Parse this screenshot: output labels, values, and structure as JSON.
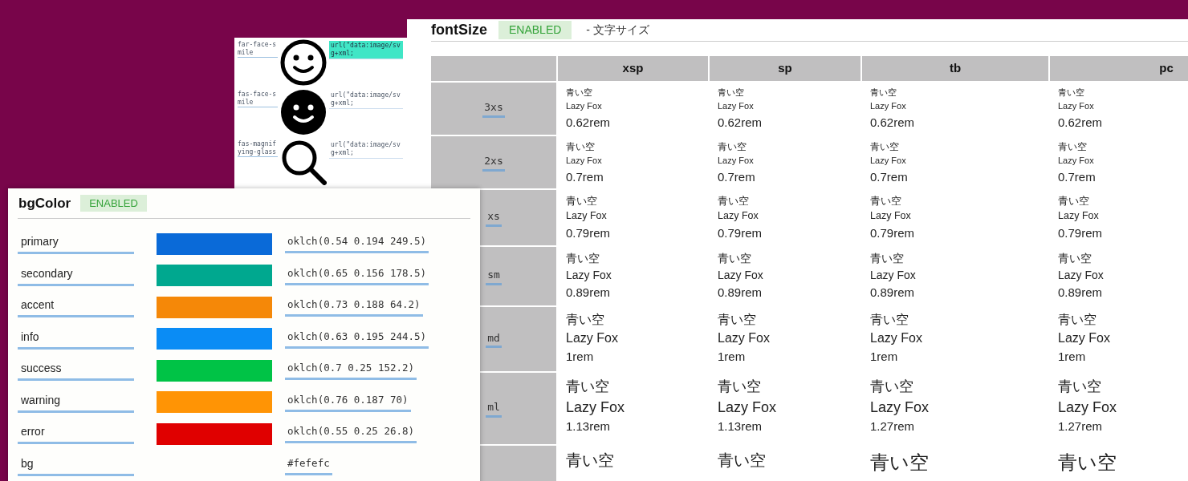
{
  "icon_panel": {
    "rows": [
      {
        "name": "far-face-smile",
        "kind": "face-outline",
        "code": "url(\"data:image/svg+xml;",
        "highlighted": true
      },
      {
        "name": "fas-face-smile",
        "kind": "face-solid",
        "code": "url(\"data:image/svg+xml;",
        "highlighted": false
      },
      {
        "name": "fas-magnifying-glass",
        "kind": "magnifier",
        "code": "url(\"data:image/svg+xml;",
        "highlighted": false
      }
    ]
  },
  "font_size": {
    "title": "fontSize",
    "badge": "ENABLED",
    "subtitle": "- 文字サイズ",
    "columns": [
      "xsp",
      "sp",
      "tb",
      "pc"
    ],
    "rows": [
      {
        "label": "3xs",
        "cells": [
          {
            "ja": "青い空",
            "en": "Lazy Fox",
            "value": "0.62rem"
          },
          {
            "ja": "青い空",
            "en": "Lazy Fox",
            "value": "0.62rem"
          },
          {
            "ja": "青い空",
            "en": "Lazy Fox",
            "value": "0.62rem"
          },
          {
            "ja": "青い空",
            "en": "Lazy Fox",
            "value": "0.62rem"
          }
        ]
      },
      {
        "label": "2xs",
        "cells": [
          {
            "ja": "青い空",
            "en": "Lazy Fox",
            "value": "0.7rem"
          },
          {
            "ja": "青い空",
            "en": "Lazy Fox",
            "value": "0.7rem"
          },
          {
            "ja": "青い空",
            "en": "Lazy Fox",
            "value": "0.7rem"
          },
          {
            "ja": "青い空",
            "en": "Lazy Fox",
            "value": "0.7rem"
          }
        ]
      },
      {
        "label": "xs",
        "cells": [
          {
            "ja": "青い空",
            "en": "Lazy Fox",
            "value": "0.79rem"
          },
          {
            "ja": "青い空",
            "en": "Lazy Fox",
            "value": "0.79rem"
          },
          {
            "ja": "青い空",
            "en": "Lazy Fox",
            "value": "0.79rem"
          },
          {
            "ja": "青い空",
            "en": "Lazy Fox",
            "value": "0.79rem"
          }
        ]
      },
      {
        "label": "sm",
        "cells": [
          {
            "ja": "青い空",
            "en": "Lazy Fox",
            "value": "0.89rem"
          },
          {
            "ja": "青い空",
            "en": "Lazy Fox",
            "value": "0.89rem"
          },
          {
            "ja": "青い空",
            "en": "Lazy Fox",
            "value": "0.89rem"
          },
          {
            "ja": "青い空",
            "en": "Lazy Fox",
            "value": "0.89rem"
          }
        ]
      },
      {
        "label": "md",
        "cells": [
          {
            "ja": "青い空",
            "en": "Lazy Fox",
            "value": "1rem"
          },
          {
            "ja": "青い空",
            "en": "Lazy Fox",
            "value": "1rem"
          },
          {
            "ja": "青い空",
            "en": "Lazy Fox",
            "value": "1rem"
          },
          {
            "ja": "青い空",
            "en": "Lazy Fox",
            "value": "1rem"
          }
        ]
      },
      {
        "label": "ml",
        "cells": [
          {
            "ja": "青い空",
            "en": "Lazy Fox",
            "value": "1.13rem"
          },
          {
            "ja": "青い空",
            "en": "Lazy Fox",
            "value": "1.13rem"
          },
          {
            "ja": "青い空",
            "en": "Lazy Fox",
            "value": "1.27rem"
          },
          {
            "ja": "青い空",
            "en": "Lazy Fox",
            "value": "1.27rem"
          }
        ]
      },
      {
        "cells": [
          {
            "ja": "青い空"
          },
          {
            "ja": "青い空"
          },
          {
            "ja": "青い空"
          },
          {
            "ja": "青い空"
          }
        ]
      }
    ]
  },
  "bg_color": {
    "title": "bgColor",
    "badge": "ENABLED",
    "rows": [
      {
        "name": "primary",
        "color": "#0a6ad8",
        "value": "oklch(0.54 0.194 249.5)"
      },
      {
        "name": "secondary",
        "color": "#00a88f",
        "value": "oklch(0.65 0.156 178.5)"
      },
      {
        "name": "accent",
        "color": "#f58808",
        "value": "oklch(0.73 0.188 64.2)"
      },
      {
        "name": "info",
        "color": "#0a8cf5",
        "value": "oklch(0.63 0.195 244.5)"
      },
      {
        "name": "success",
        "color": "#00c346",
        "value": "oklch(0.7 0.25 152.2)"
      },
      {
        "name": "warning",
        "color": "#ff9405",
        "value": "oklch(0.76 0.187 70)"
      },
      {
        "name": "error",
        "color": "#e00000",
        "value": "oklch(0.55 0.25 26.8)"
      },
      {
        "name": "bg",
        "value": "#fefefc"
      }
    ]
  }
}
